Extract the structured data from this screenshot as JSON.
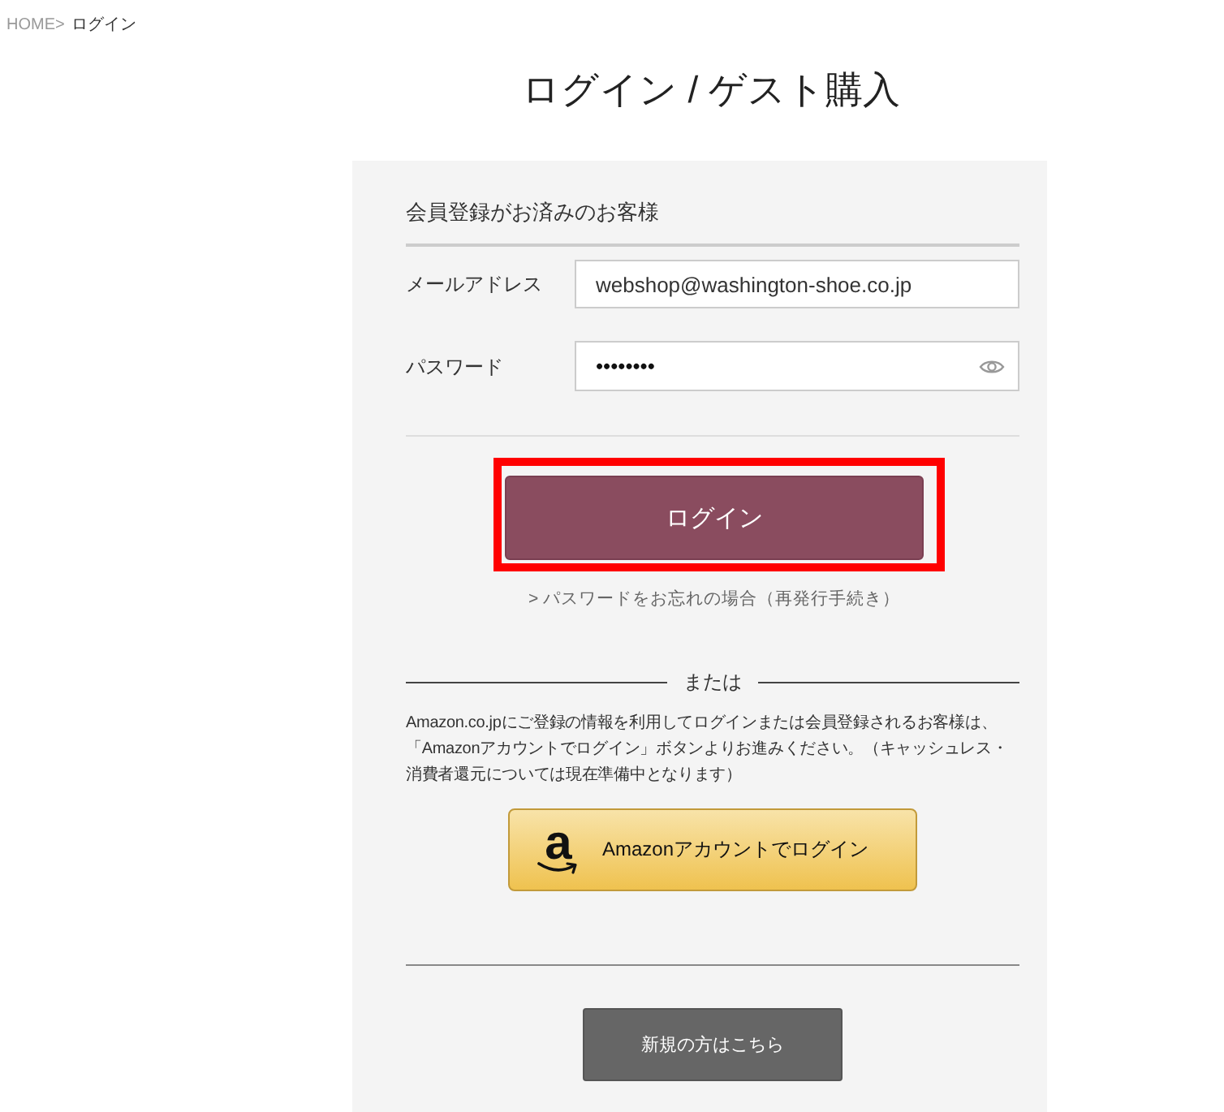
{
  "breadcrumb": [
    {
      "label": "HOME>",
      "current": false
    },
    {
      "label": "ログイン",
      "current": true
    }
  ],
  "title": "ログイン / ゲスト購入",
  "member_login": {
    "heading": "会員登録がお済みのお客様",
    "fields": [
      {
        "kind": "text",
        "label": "メールアドレス",
        "value": "webshop@washington-shoe.co.jp"
      },
      {
        "kind": "password",
        "label": "パスワード",
        "value": "••••••••"
      }
    ],
    "login_button": {
      "label": "ログイン",
      "highlighted": true
    },
    "forgot_link": "> パスワードをお忘れの場合（再発行手続き）"
  },
  "divider_text": "または",
  "amazon": {
    "note": "Amazon.co.jpにご登録の情報を利用してログインまたは会員登録されるお客様は、「Amazonアカウントでログイン」ボタンよりお進みください。（キャッシュレス・消費者還元については現在準備中となります）",
    "button": {
      "logo_letter": "a",
      "label": "Amazonアカウントでログイン"
    }
  },
  "new_customer_button": "新規の方はこちら"
}
